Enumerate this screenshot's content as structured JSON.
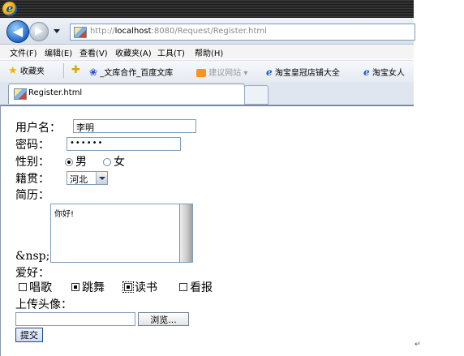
{
  "browser": {
    "address_host": "http://",
    "address_bold": "localhost",
    "address_rest": ":8080/Request/Register.html",
    "menu": [
      "文件(F)",
      "编辑(E)",
      "查看(V)",
      "收藏夹(A)",
      "工具(T)",
      "帮助(H)"
    ],
    "favorites_label": "收藏夹",
    "favorites": [
      "_文库合作_百度文库",
      "建议网站 ▾",
      "淘宝皇冠店铺大全",
      "淘宝女人"
    ],
    "tab_title": "Register.html"
  },
  "form": {
    "username_label": "用户名：",
    "username_value": "李明",
    "password_label": "密码：",
    "password_value": "••••••",
    "gender_label": "性别：",
    "gender_options": [
      "男",
      "女"
    ],
    "gender_selected": "男",
    "origin_label": "籍贯：",
    "origin_value": "河北",
    "resume_label": "简历：",
    "resume_value": "你好!",
    "nbsp_text": "&nsp;",
    "hobby_label": "爱好：",
    "hobbies": [
      "唱歌",
      "跳舞",
      "读书",
      "看报"
    ],
    "hobbies_checked": [
      "跳舞",
      "读书"
    ],
    "upload_label": "上传头像：",
    "browse_label": "浏览...",
    "submit_label": "提交"
  },
  "colors": {
    "accent": "#1f67c7",
    "border": "#7f9db9"
  }
}
